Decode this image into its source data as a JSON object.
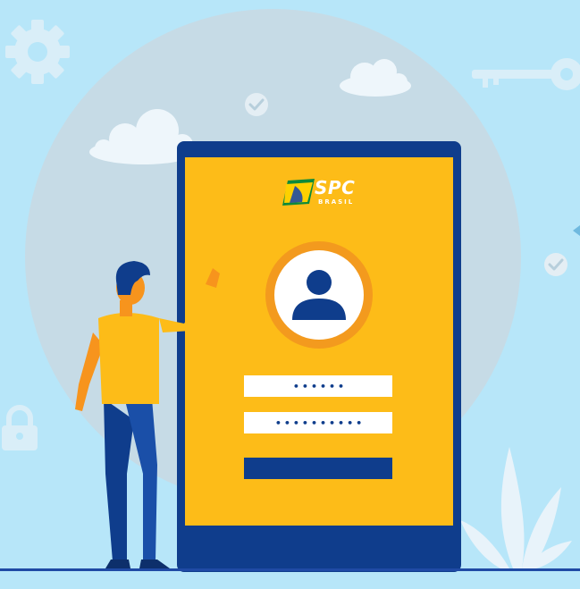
{
  "brand": {
    "logo_text": "SPC",
    "logo_subtext": "BRASIL"
  },
  "login_form": {
    "username_value": "••••••",
    "password_value": "••••••••••",
    "submit_label": ""
  },
  "colors": {
    "background": "#b7e6f9",
    "phone_frame": "#0f3d8c",
    "screen": "#fdbc18",
    "avatar_ring": "#f39a1e",
    "accent_blue": "#1f4aa5"
  },
  "icons": [
    "gear-icon",
    "cloud-icon",
    "check-icon",
    "key-icon",
    "padlock-icon",
    "user-icon",
    "plant-icon"
  ]
}
